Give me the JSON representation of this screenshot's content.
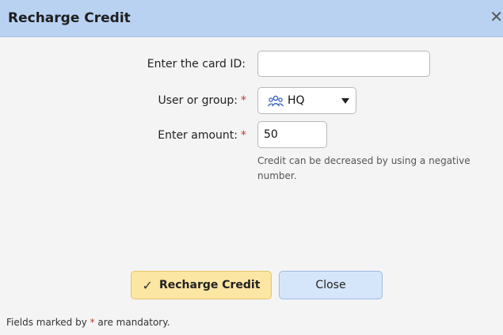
{
  "dialog": {
    "title": "Recharge Credit",
    "close_glyph": "✕"
  },
  "form": {
    "card_id": {
      "label": "Enter the card ID:",
      "value": ""
    },
    "user_group": {
      "label": "User or group:",
      "required_marker": "*",
      "value": "HQ",
      "icon": "users-group-icon"
    },
    "amount": {
      "label": "Enter amount:",
      "required_marker": "*",
      "value": "50"
    },
    "hint": "Credit can be decreased by using a negative number."
  },
  "buttons": {
    "recharge_label": "Recharge Credit",
    "close_label": "Close"
  },
  "footer": {
    "before": "Fields marked by ",
    "marker": "*",
    "after": " are mandatory."
  },
  "colors": {
    "title_bar": "#b9d2f2",
    "primary_button": "#fce6a4",
    "secondary_button": "#d6e6fa",
    "required": "#c0392b"
  }
}
